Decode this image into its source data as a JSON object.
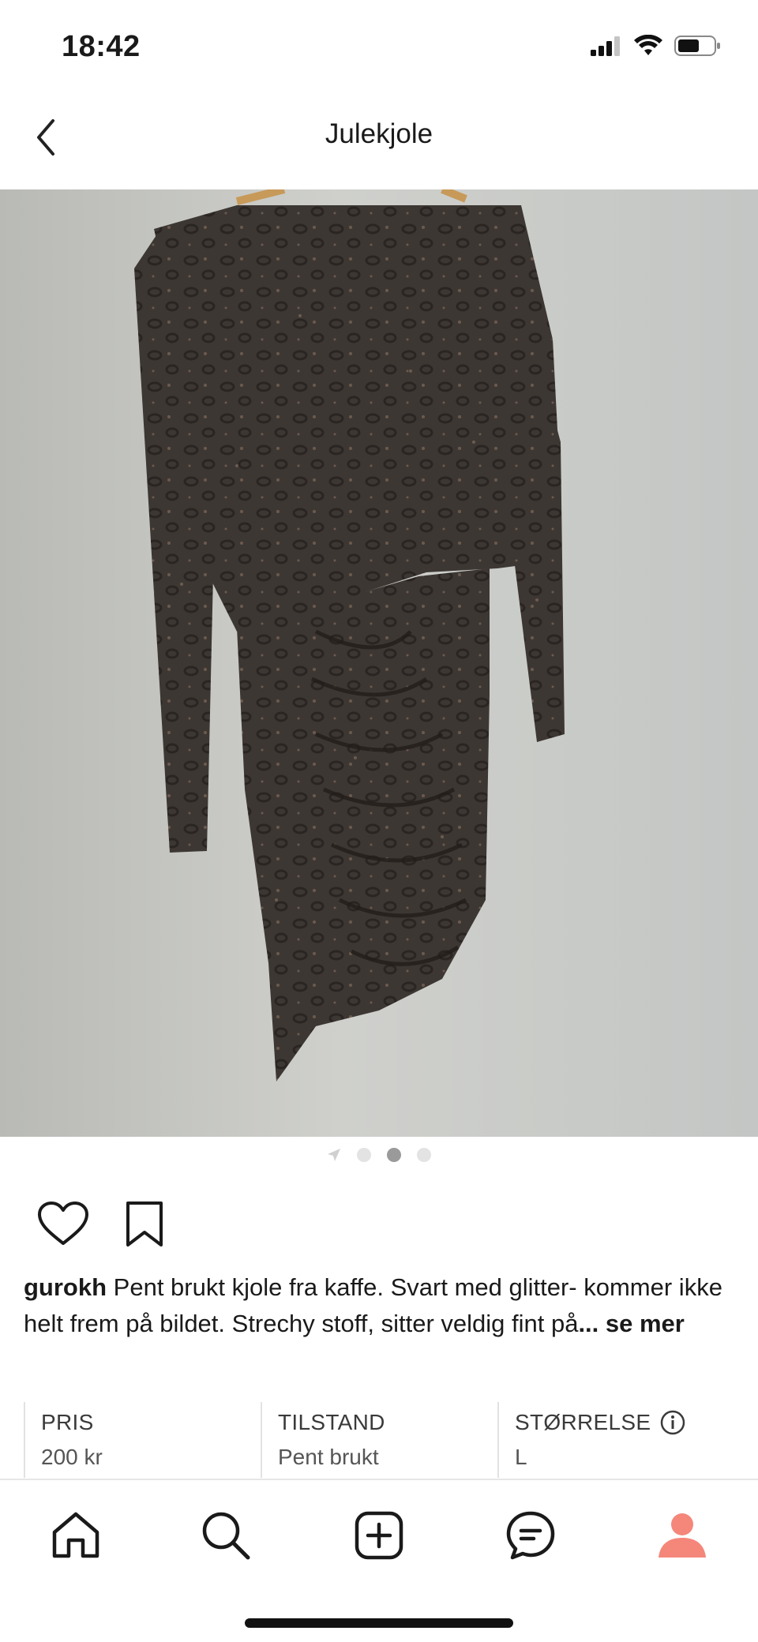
{
  "status_bar": {
    "time": "18:42"
  },
  "header": {
    "title": "Julekjole"
  },
  "gallery": {
    "dot_count": 3,
    "active_index": 1
  },
  "listing": {
    "username": "gurokh",
    "description": " Pent brukt kjole fra kaffe. Svart med glitter- kommer ikke helt frem på bildet. Strechy stoff, sitter veldig fint på",
    "see_more": "... se mer"
  },
  "attributes": {
    "price_label": "PRIS",
    "price_value": "200 kr",
    "condition_label": "TILSTAND",
    "condition_value": "Pent brukt",
    "size_label": "STØRRELSE",
    "size_value": "L"
  },
  "icons": [
    "back-icon",
    "heart-icon",
    "bookmark-icon",
    "location-arrow-icon",
    "info-icon",
    "home-icon",
    "search-icon",
    "add-icon",
    "messages-icon",
    "profile-icon"
  ],
  "colors": {
    "accent_profile": "#f4877a",
    "dot_active": "#9a9a9a",
    "dot_inactive": "#e3e3e3"
  }
}
